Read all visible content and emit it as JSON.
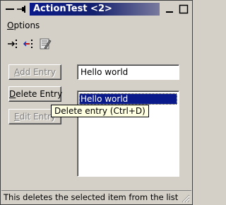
{
  "window": {
    "title": "ActionTest <2>"
  },
  "menubar": {
    "options_accel": "O",
    "options_rest": "ptions"
  },
  "toolbar": {
    "icons": [
      "add-entry-tool-icon",
      "delete-entry-tool-icon",
      "edit-entry-tool-icon"
    ]
  },
  "buttons": {
    "add": {
      "accel": "A",
      "rest": "dd Entry"
    },
    "delete": {
      "accel": "D",
      "rest": "elete Entry"
    },
    "edit": {
      "accel": "E",
      "rest": "dit Entry"
    }
  },
  "text_field": {
    "value": "Hello world"
  },
  "list": {
    "items": [
      "Hello world"
    ],
    "selected_index": 0
  },
  "tooltip": {
    "text": "Delete entry (Ctrl+D)"
  },
  "status": {
    "text": "This deletes the selected item from the list"
  },
  "colors": {
    "title_bg": "#0a1a8a",
    "selection_bg": "#0a1a8a",
    "tooltip_bg": "#ffffe1",
    "window_bg": "#d4d0c8"
  }
}
